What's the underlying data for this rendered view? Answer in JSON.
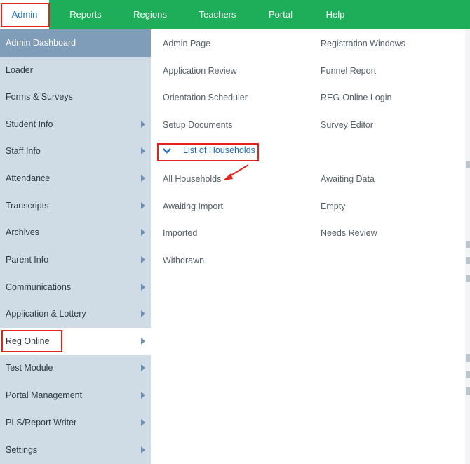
{
  "nav": {
    "tabs": [
      {
        "label": "Admin"
      },
      {
        "label": "Reports"
      },
      {
        "label": "Regions"
      },
      {
        "label": "Teachers"
      },
      {
        "label": "Portal"
      },
      {
        "label": "Help"
      }
    ],
    "active": "Admin",
    "bar_color": "#1eae5a"
  },
  "sidebar": {
    "items": [
      {
        "label": "Admin Dashboard"
      },
      {
        "label": "Loader"
      },
      {
        "label": "Forms & Surveys"
      },
      {
        "label": "Student Info"
      },
      {
        "label": "Staff Info"
      },
      {
        "label": "Attendance"
      },
      {
        "label": "Transcripts"
      },
      {
        "label": "Archives"
      },
      {
        "label": "Parent Info"
      },
      {
        "label": "Communications"
      },
      {
        "label": "Application & Lottery"
      },
      {
        "label": "Reg Online"
      },
      {
        "label": "Test Module"
      },
      {
        "label": "Portal Management"
      },
      {
        "label": "PLS/Report Writer"
      },
      {
        "label": "Settings"
      }
    ],
    "selected": "Reg Online"
  },
  "panel": {
    "links_col1": [
      "Admin Page",
      "Application Review",
      "Orientation Scheduler",
      "Setup Documents"
    ],
    "links_col2": [
      "Registration Windows",
      "Funnel Report",
      "REG-Online Login",
      "Survey Editor"
    ],
    "submenu_title": "List of Households",
    "households_col1": [
      "All Households",
      "Awaiting Import",
      "Imported",
      "Withdrawn"
    ],
    "households_col2": [
      "Awaiting Data",
      "Empty",
      "Needs Review"
    ]
  },
  "icons": {
    "expand": "chevron-down-icon",
    "submenu": "caret-right-icon",
    "annotation": "red-arrow-icon"
  },
  "colors": {
    "highlight": "#e0241b",
    "link": "#1f6fb5",
    "sidebar": "#cfdbe5",
    "sidebar_header": "#7f9cb8"
  }
}
